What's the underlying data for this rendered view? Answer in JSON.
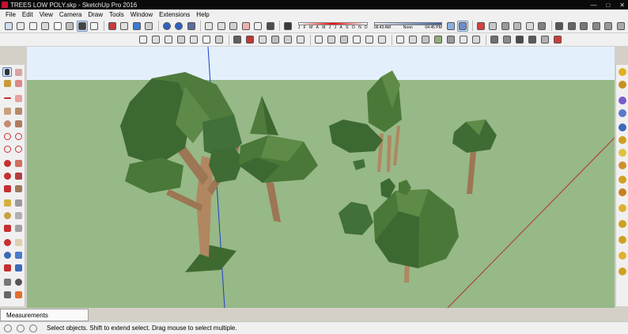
{
  "window": {
    "title": "TREES LOW POLY.skp - SketchUp Pro 2016",
    "controls": [
      "—",
      "□",
      "✕"
    ]
  },
  "menu": [
    "File",
    "Edit",
    "View",
    "Camera",
    "Draw",
    "Tools",
    "Window",
    "Extensions",
    "Help"
  ],
  "shadow_settings": {
    "months": [
      "J",
      "F",
      "M",
      "A",
      "M",
      "J",
      "J",
      "A",
      "S",
      "O",
      "N",
      "D"
    ],
    "time_start": "06:43 AM",
    "time_noon": "Noon",
    "time_end": "04:45 PM"
  },
  "measurements": {
    "label": "Measurements"
  },
  "status": {
    "text": "Select objects. Shift to extend select. Drag mouse to select multiple."
  },
  "colors": {
    "sky": "#e3f0fb",
    "ground": "#97b887",
    "foliage_dark": "#3f6a33",
    "foliage_mid": "#4f7a3d",
    "foliage_light": "#5e8b47",
    "trunk": "#b08760",
    "trunk_dark": "#7a5a3c",
    "axis_blue": "#1f3ec8",
    "axis_red": "#b0303a"
  },
  "toolbar_icons": {
    "row1": [
      "rect-icon",
      "cube-icon",
      "tape-icon",
      "paint-icon",
      "components-icon",
      "styles-icon",
      "xray-icon",
      "undo-icon",
      "redo-icon",
      "save-icon",
      "cut-icon",
      "copy-icon",
      "paste-icon",
      "erase-icon",
      "print-icon",
      "model-info-icon",
      "soften-icon"
    ],
    "row2": [
      "orbit-icon",
      "pan-icon",
      "zoom-icon",
      "zoom-extents-icon",
      "iso-view-icon",
      "top-view-icon",
      "front-view-icon",
      "right-view-icon",
      "back-view-icon",
      "left-view-icon",
      "section-plane-icon",
      "section-display-icon",
      "wireframe-icon",
      "hidden-line-icon",
      "shaded-icon",
      "textured-icon",
      "monochrome-icon",
      "xray-toggle-icon"
    ]
  }
}
